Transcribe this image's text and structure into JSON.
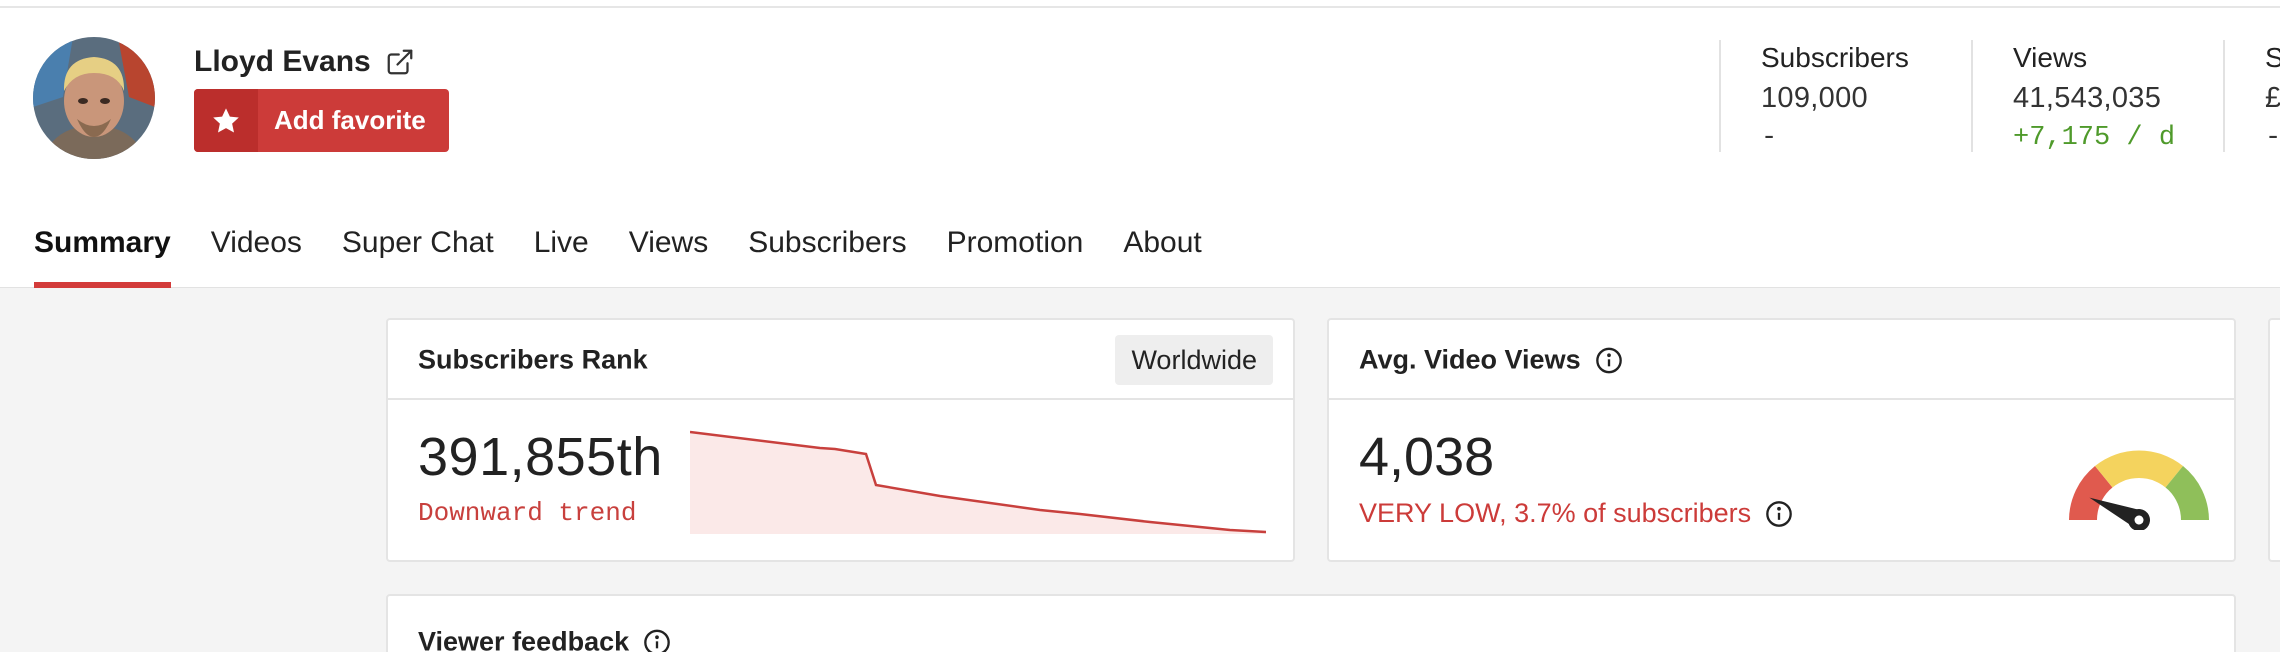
{
  "channel": {
    "name": "Lloyd Evans",
    "favorite_label": "Add favorite"
  },
  "stats": [
    {
      "label": "Subscribers",
      "value": "109,000",
      "delta": "-"
    },
    {
      "label": "Views",
      "value": "41,543,035",
      "delta": "+7,175 / d"
    },
    {
      "label": "S",
      "value": "£",
      "delta": "-"
    }
  ],
  "tabs": [
    "Summary",
    "Videos",
    "Super Chat",
    "Live",
    "Views",
    "Subscribers",
    "Promotion",
    "About"
  ],
  "rank_card": {
    "title": "Subscribers Rank",
    "region": "Worldwide",
    "value": "391,855th",
    "trend": "Downward trend"
  },
  "avg_card": {
    "title": "Avg. Video Views",
    "value": "4,038",
    "note": "VERY LOW, 3.7% of subscribers",
    "gauge_level": 0.04
  },
  "feedback_card": {
    "title": "Viewer feedback"
  },
  "colors": {
    "accent": "#cc3b39",
    "positive": "#4f9a2b",
    "gauge_low": "#e05a4e",
    "gauge_mid": "#f4d35e",
    "gauge_high": "#8fbf5a"
  },
  "icons": {
    "external": "external-link-icon",
    "star": "star-icon",
    "info": "info-icon"
  }
}
